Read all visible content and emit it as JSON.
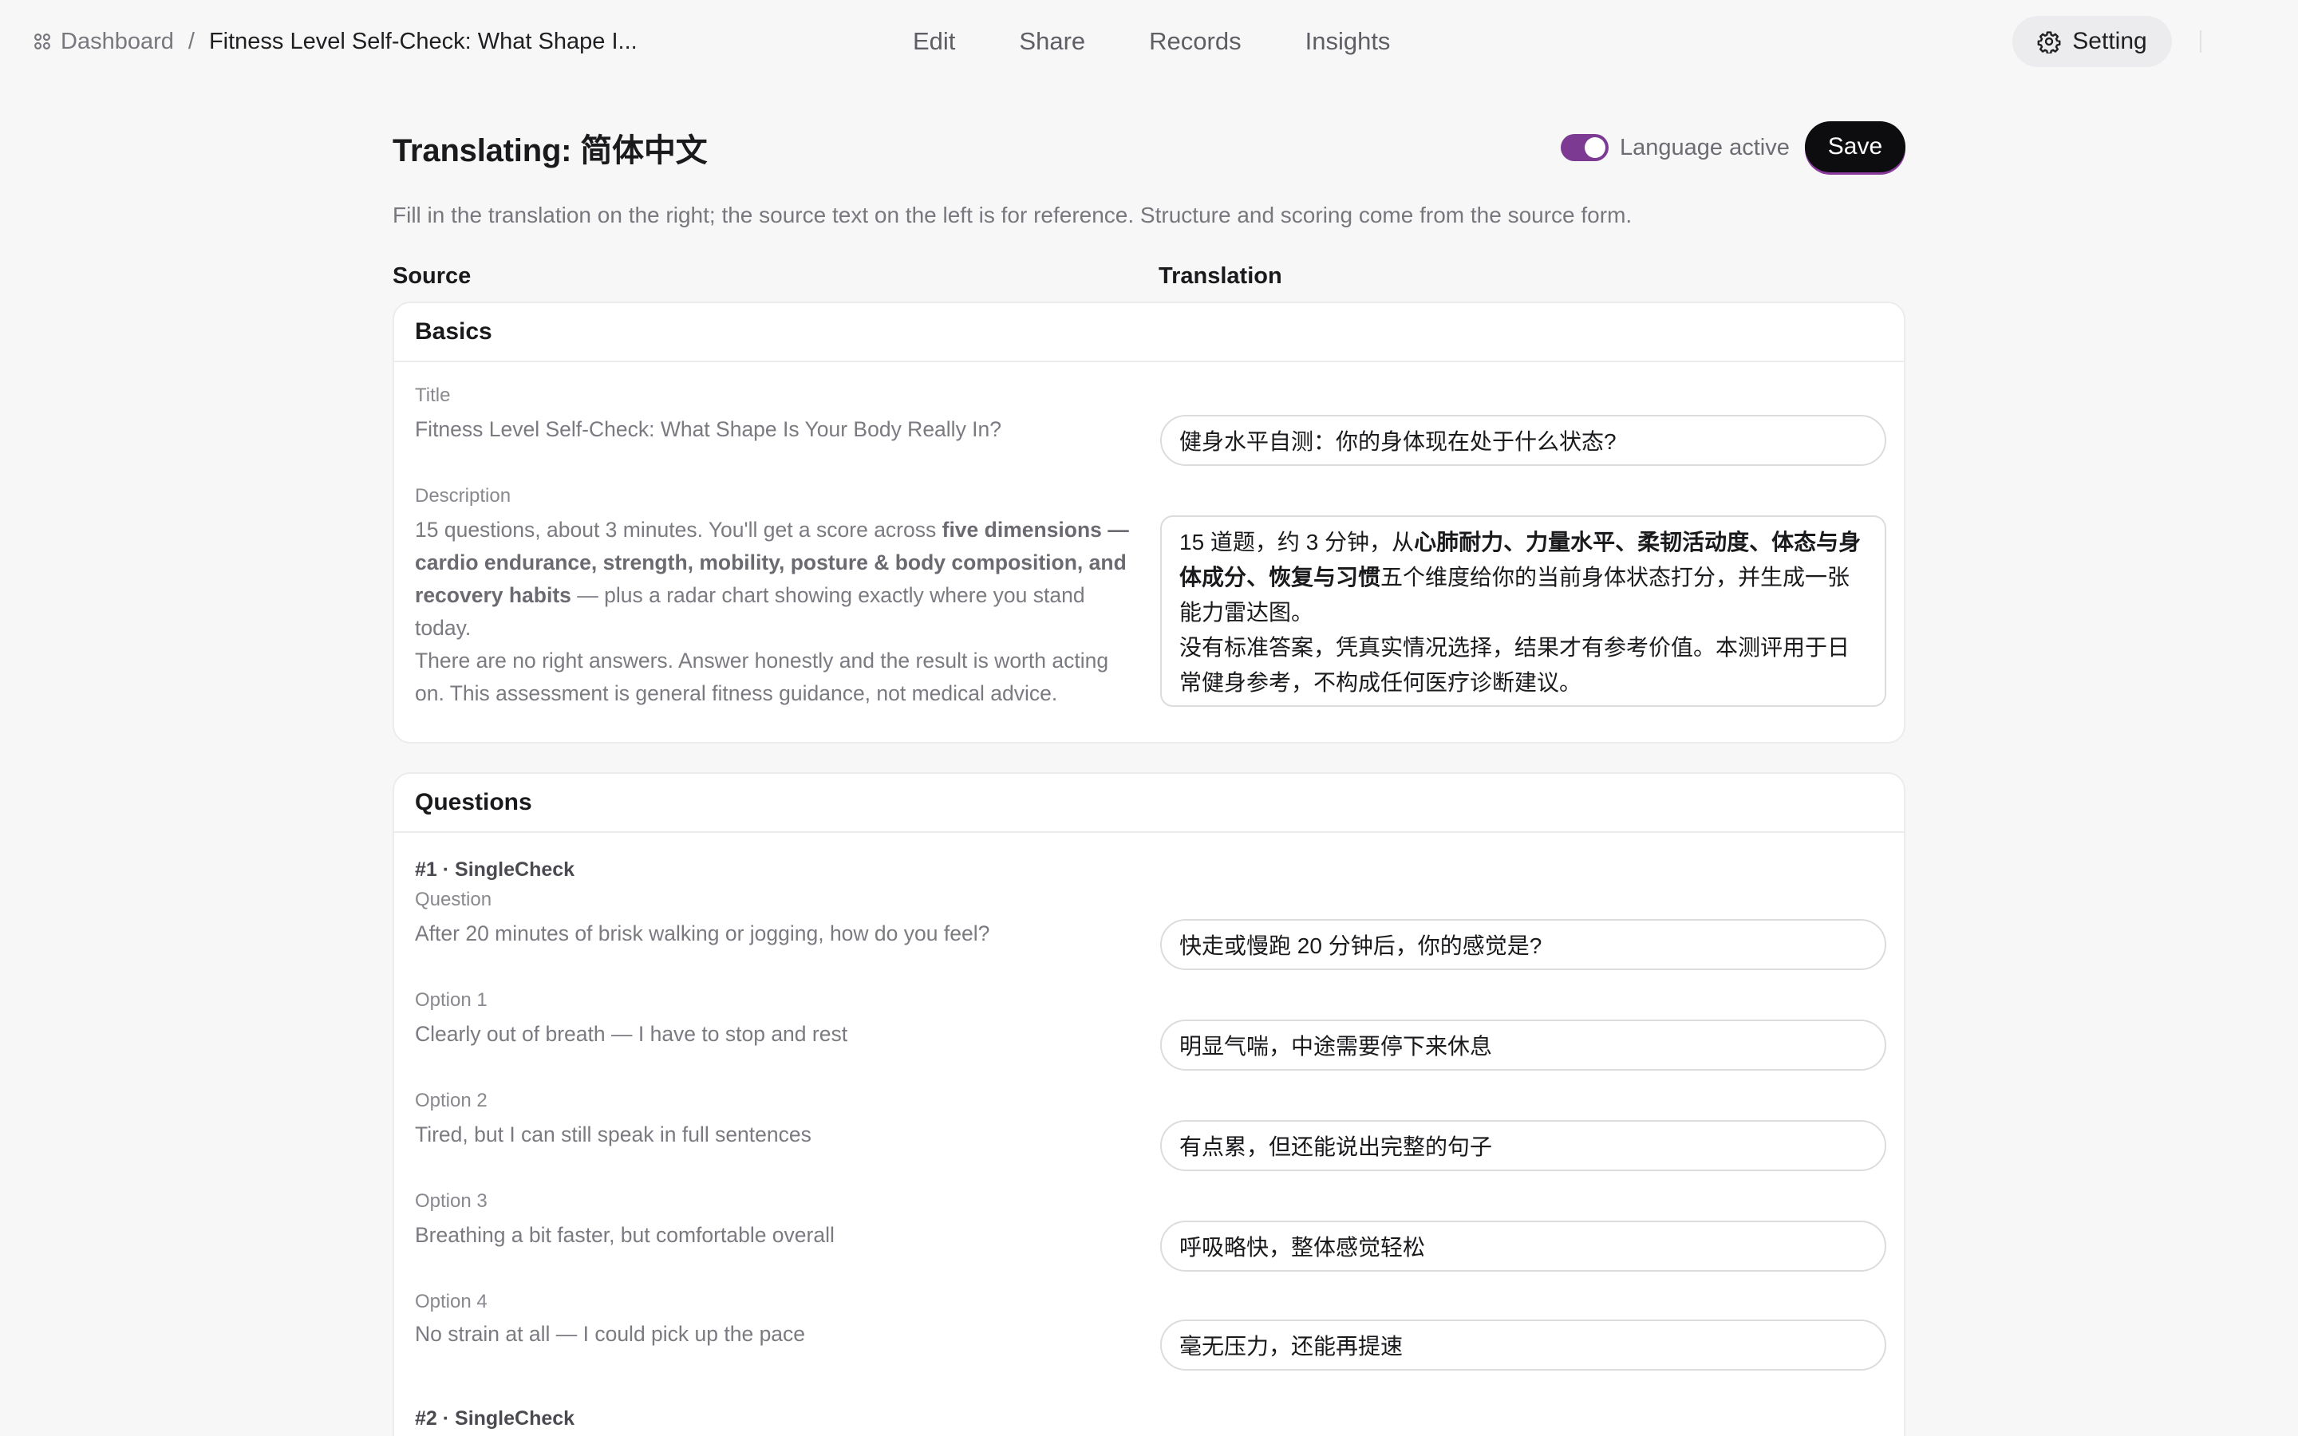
{
  "breadcrumb": {
    "root": "Dashboard",
    "separator": "/",
    "current": "Fitness Level Self-Check: What Shape I..."
  },
  "nav": [
    "Edit",
    "Share",
    "Records",
    "Insights"
  ],
  "setting_label": "Setting",
  "header": {
    "title": "Translating: 简体中文",
    "language_active_label": "Language active",
    "language_active": true,
    "save_label": "Save",
    "description": "Fill in the translation on the right; the source text on the left is for reference. Structure and scoring come from the source form."
  },
  "columns": {
    "source": "Source",
    "translation": "Translation"
  },
  "basics": {
    "heading": "Basics",
    "title_label": "Title",
    "title_source": "Fitness Level Self-Check: What Shape Is Your Body Really In?",
    "title_translation": "健身水平自测：你的身体现在处于什么状态?",
    "description_label": "Description",
    "description_source": {
      "p1_a": "15 questions, about 3 minutes. You'll get a score across ",
      "p1_b": "five dimensions — cardio endurance, strength, mobility, posture & body composition, and recovery habits",
      "p1_c": " — plus a radar chart showing exactly where you stand today.",
      "p2": "There are no right answers. Answer honestly and the result is worth acting on. This assessment is general fitness guidance, not medical advice."
    },
    "description_translation": {
      "p1_a": "15 道题，约 3 分钟，从",
      "p1_b": "心肺耐力、力量水平、柔韧活动度、体态与身体成分、恢复与习惯",
      "p1_c": "五个维度给你的当前身体状态打分，并生成一张能力雷达图。",
      "p2": "没有标准答案，凭真实情况选择，结果才有参考价值。本测评用于日常健身参考，不构成任何医疗诊断建议。"
    }
  },
  "questions": {
    "heading": "Questions",
    "items": [
      {
        "type_label": "#1 · SingleCheck",
        "question_label": "Question",
        "question_source": "After 20 minutes of brisk walking or jogging, how do you feel?",
        "question_translation": "快走或慢跑 20 分钟后，你的感觉是?",
        "options": [
          {
            "label": "Option 1",
            "source": "Clearly out of breath — I have to stop and rest",
            "translation": "明显气喘，中途需要停下来休息"
          },
          {
            "label": "Option 2",
            "source": "Tired, but I can still speak in full sentences",
            "translation": "有点累，但还能说出完整的句子"
          },
          {
            "label": "Option 3",
            "source": "Breathing a bit faster, but comfortable overall",
            "translation": "呼吸略快，整体感觉轻松"
          },
          {
            "label": "Option 4",
            "source": "No strain at all — I could pick up the pace",
            "translation": "毫无压力，还能再提速"
          }
        ]
      },
      {
        "type_label": "#2 · SingleCheck"
      }
    ]
  },
  "colors": {
    "accent": "#7c3a92",
    "primary_button": "#0d0d0f",
    "background": "#f7f7f8"
  },
  "icons": {
    "dashboard": "grid-icon",
    "setting": "gear-icon"
  }
}
